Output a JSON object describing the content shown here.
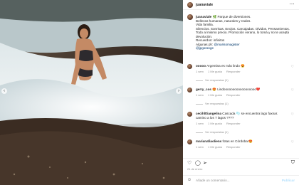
{
  "post": {
    "username": "juanaviale",
    "more_icon": "more-horizontal-icon"
  },
  "caption": {
    "username": "juanaviale",
    "lines": [
      "🌿 Parque de diversiones.",
      "Bellezas humanas, naturales y reales.",
      "Vida familia.",
      "Silencios. Sonrisas. Enojos. Carcajadas. Olvidos. Pensamientos.",
      "Todo al mismo precio. Promoción verano, lo tomá y no te aceptá",
      "devolución.",
      "Recuerdos: infinitos",
      "Algunas ph:"
    ],
    "tag1": "@marisomagister",
    "tag2": "@jpgorange"
  },
  "comments": [
    {
      "username": "ooooo",
      "text": "Argentina es más lindo 😍",
      "age": "1 sem",
      "likes": "1 Me gusta",
      "reply": "Responder",
      "replies": "Ver respuestas (1)"
    },
    {
      "username": "gerry_cos",
      "text": "😍 Lindoooooooooooooooooo❤️",
      "age": "1 sem",
      "likes": "1 Me gusta",
      "reply": "Responder",
      "replies": "Ver respuestas (1)"
    },
    {
      "username": "cecihlttiangelina",
      "text": "Cascada 🫧 se encuentra lago faxnar. camino a los 7 lagos ????",
      "age": "1 sem",
      "likes": "1 Me gusta",
      "reply": "Responder",
      "replies": "Ver respuestas (1)"
    },
    {
      "username": "marianafiaoliens",
      "text": "fotas en Córdoba!😍",
      "age": "1 sem",
      "likes": "1 Me gusta",
      "reply": "Responder",
      "replies": ""
    }
  ],
  "footer": {
    "date": "21 de enero",
    "comment_placeholder": "Añade un comentario...",
    "post_label": "Publicar"
  },
  "colors": {
    "link": "#00376b",
    "muted": "#8e8e8e",
    "post_button": "#b2dffc"
  }
}
